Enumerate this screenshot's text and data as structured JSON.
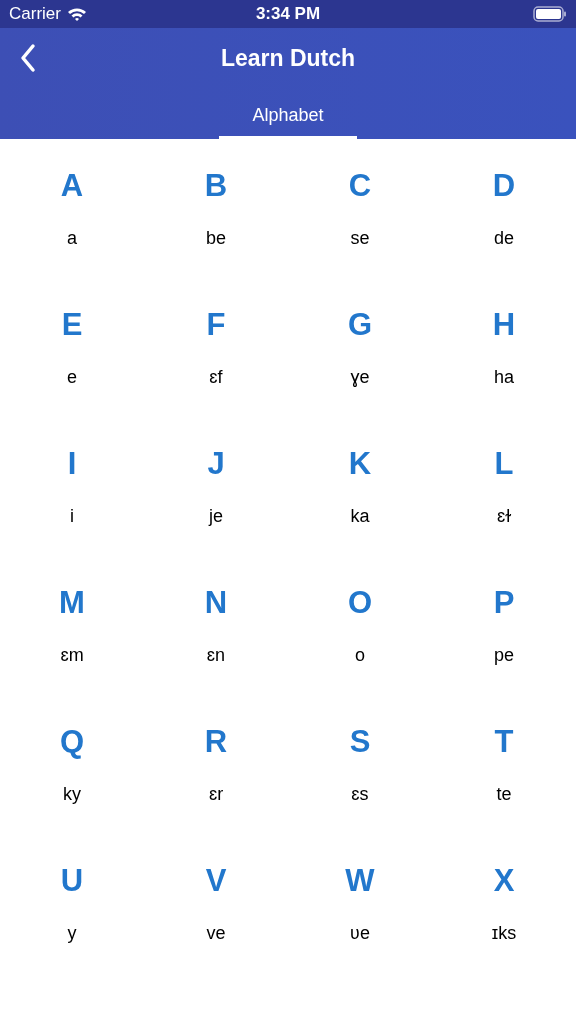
{
  "status_bar": {
    "carrier": "Carrier",
    "time": "3:34 PM"
  },
  "nav": {
    "title": "Learn Dutch"
  },
  "tabs": [
    {
      "label": "Alphabet",
      "selected": true
    }
  ],
  "letters": [
    {
      "letter": "A",
      "sound": "a"
    },
    {
      "letter": "B",
      "sound": "be"
    },
    {
      "letter": "C",
      "sound": "se"
    },
    {
      "letter": "D",
      "sound": "de"
    },
    {
      "letter": "E",
      "sound": "e"
    },
    {
      "letter": "F",
      "sound": "ɛf"
    },
    {
      "letter": "G",
      "sound": "ɣe"
    },
    {
      "letter": "H",
      "sound": "ha"
    },
    {
      "letter": "I",
      "sound": "i"
    },
    {
      "letter": "J",
      "sound": "je"
    },
    {
      "letter": "K",
      "sound": "ka"
    },
    {
      "letter": "L",
      "sound": "ɛɫ"
    },
    {
      "letter": "M",
      "sound": "ɛm"
    },
    {
      "letter": "N",
      "sound": "ɛn"
    },
    {
      "letter": "O",
      "sound": "o"
    },
    {
      "letter": "P",
      "sound": "pe"
    },
    {
      "letter": "Q",
      "sound": "ky"
    },
    {
      "letter": "R",
      "sound": "ɛr"
    },
    {
      "letter": "S",
      "sound": "ɛs"
    },
    {
      "letter": "T",
      "sound": "te"
    },
    {
      "letter": "U",
      "sound": "y"
    },
    {
      "letter": "V",
      "sound": "ve"
    },
    {
      "letter": "W",
      "sound": "ʋe"
    },
    {
      "letter": "X",
      "sound": "ɪks"
    }
  ]
}
